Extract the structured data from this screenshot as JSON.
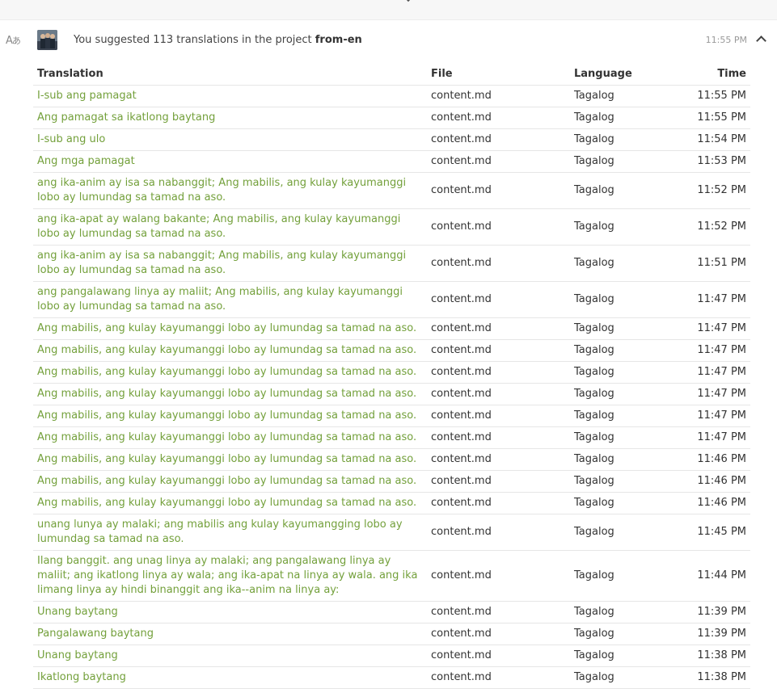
{
  "header": {
    "summary_prefix": "You suggested 113 translations in the project",
    "project": "from-en",
    "timestamp": "11:55 PM",
    "activity_icon": "translate-icon",
    "collapse_icon": "chevron-up-icon"
  },
  "table": {
    "columns": {
      "translation": "Translation",
      "file": "File",
      "language": "Language",
      "time": "Time"
    },
    "rows": [
      {
        "translation": "I-sub ang pamagat",
        "file": "content.md",
        "language": "Tagalog",
        "time": "11:55 PM"
      },
      {
        "translation": "Ang pamagat sa ikatlong baytang",
        "file": "content.md",
        "language": "Tagalog",
        "time": "11:55 PM"
      },
      {
        "translation": "I-sub ang ulo",
        "file": "content.md",
        "language": "Tagalog",
        "time": "11:54 PM"
      },
      {
        "translation": "Ang mga pamagat",
        "file": "content.md",
        "language": "Tagalog",
        "time": "11:53 PM"
      },
      {
        "translation": "ang ika-anim ay isa sa nabanggit; Ang mabilis, ang kulay kayumanggi lobo ay lumundag sa tamad na aso.",
        "file": "content.md",
        "language": "Tagalog",
        "time": "11:52 PM"
      },
      {
        "translation": "ang ika-apat ay walang bakante; Ang mabilis, ang kulay kayumanggi lobo ay lumundag sa tamad na aso.",
        "file": "content.md",
        "language": "Tagalog",
        "time": "11:52 PM"
      },
      {
        "translation": "ang ika-anim ay isa sa nabanggit; Ang mabilis, ang kulay kayumanggi lobo ay lumundag sa tamad na aso.",
        "file": "content.md",
        "language": "Tagalog",
        "time": "11:51 PM"
      },
      {
        "translation": "ang pangalawang linya ay maliit; Ang mabilis, ang kulay kayumanggi lobo ay lumundag sa tamad na aso.",
        "file": "content.md",
        "language": "Tagalog",
        "time": "11:47 PM"
      },
      {
        "translation": "Ang mabilis, ang kulay kayumanggi lobo ay lumundag sa tamad na aso.",
        "file": "content.md",
        "language": "Tagalog",
        "time": "11:47 PM"
      },
      {
        "translation": "Ang mabilis, ang kulay kayumanggi lobo ay lumundag sa tamad na aso.",
        "file": "content.md",
        "language": "Tagalog",
        "time": "11:47 PM"
      },
      {
        "translation": "Ang mabilis, ang kulay kayumanggi lobo ay lumundag sa tamad na aso.",
        "file": "content.md",
        "language": "Tagalog",
        "time": "11:47 PM"
      },
      {
        "translation": "Ang mabilis, ang kulay kayumanggi lobo ay lumundag sa tamad na aso.",
        "file": "content.md",
        "language": "Tagalog",
        "time": "11:47 PM"
      },
      {
        "translation": "Ang mabilis, ang kulay kayumanggi lobo ay lumundag sa tamad na aso.",
        "file": "content.md",
        "language": "Tagalog",
        "time": "11:47 PM"
      },
      {
        "translation": "Ang mabilis, ang kulay kayumanggi lobo ay lumundag sa tamad na aso.",
        "file": "content.md",
        "language": "Tagalog",
        "time": "11:47 PM"
      },
      {
        "translation": "Ang mabilis, ang kulay kayumanggi lobo ay lumundag sa tamad na aso.",
        "file": "content.md",
        "language": "Tagalog",
        "time": "11:46 PM"
      },
      {
        "translation": "Ang mabilis, ang kulay kayumanggi lobo ay lumundag sa tamad na aso.",
        "file": "content.md",
        "language": "Tagalog",
        "time": "11:46 PM"
      },
      {
        "translation": "Ang mabilis, ang kulay kayumanggi lobo ay lumundag sa tamad na aso.",
        "file": "content.md",
        "language": "Tagalog",
        "time": "11:46 PM"
      },
      {
        "translation": "unang lunya ay malaki; ang mabilis ang kulay kayumangging lobo ay lumundag sa tamad na aso.",
        "file": "content.md",
        "language": "Tagalog",
        "time": "11:45 PM"
      },
      {
        "translation": "Ilang banggit. ang unag linya ay malaki; ang pangalawang linya ay maliit; ang ikatlong linya ay wala; ang ika-apat na linya ay wala. ang ika limang linya ay hindi binanggit ang ika--anim na linya ay:",
        "file": "content.md",
        "language": "Tagalog",
        "time": "11:44 PM"
      },
      {
        "translation": "Unang baytang",
        "file": "content.md",
        "language": "Tagalog",
        "time": "11:39 PM"
      },
      {
        "translation": "Pangalawang baytang",
        "file": "content.md",
        "language": "Tagalog",
        "time": "11:39 PM"
      },
      {
        "translation": "Unang baytang",
        "file": "content.md",
        "language": "Tagalog",
        "time": "11:38 PM"
      },
      {
        "translation": "Ikatlong baytang",
        "file": "content.md",
        "language": "Tagalog",
        "time": "11:38 PM"
      }
    ]
  },
  "colors": {
    "translation_link": "#73a03b",
    "divider": "#e6e6e6",
    "muted": "#999999"
  }
}
